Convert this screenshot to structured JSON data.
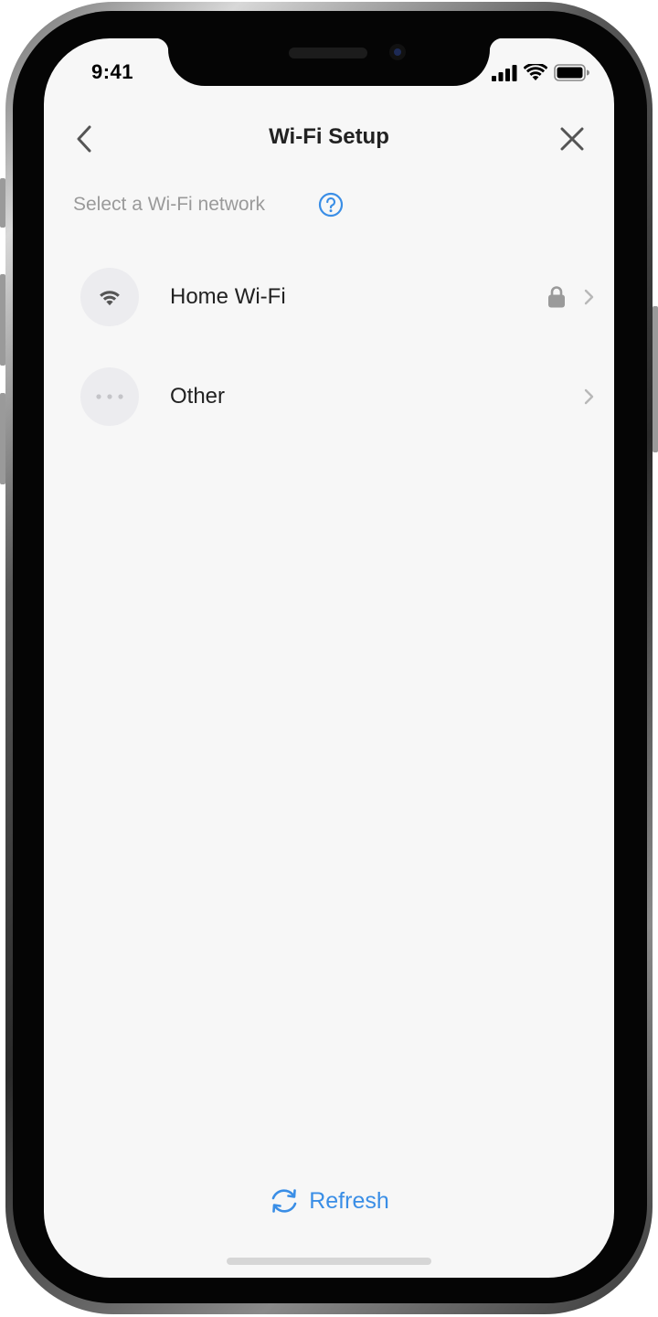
{
  "status_bar": {
    "time": "9:41",
    "icons": [
      "signal-icon",
      "wifi-icon",
      "battery-icon"
    ]
  },
  "nav": {
    "title": "Wi-Fi Setup",
    "back_icon": "chevron-left-icon",
    "close_icon": "close-icon"
  },
  "section": {
    "label": "Select a Wi-Fi network",
    "help_icon": "help-circle-icon"
  },
  "networks": [
    {
      "name": "Home Wi-Fi",
      "icon": "wifi-icon",
      "secured": true
    },
    {
      "name": "Other",
      "icon": "more-dots-icon",
      "secured": false
    }
  ],
  "refresh": {
    "label": "Refresh",
    "icon": "refresh-icon"
  },
  "colors": {
    "accent": "#3a8ee6",
    "background": "#f7f7f7",
    "title_text": "#222222",
    "muted_text": "#9a9a9a",
    "icon_circle": "#ececef"
  }
}
